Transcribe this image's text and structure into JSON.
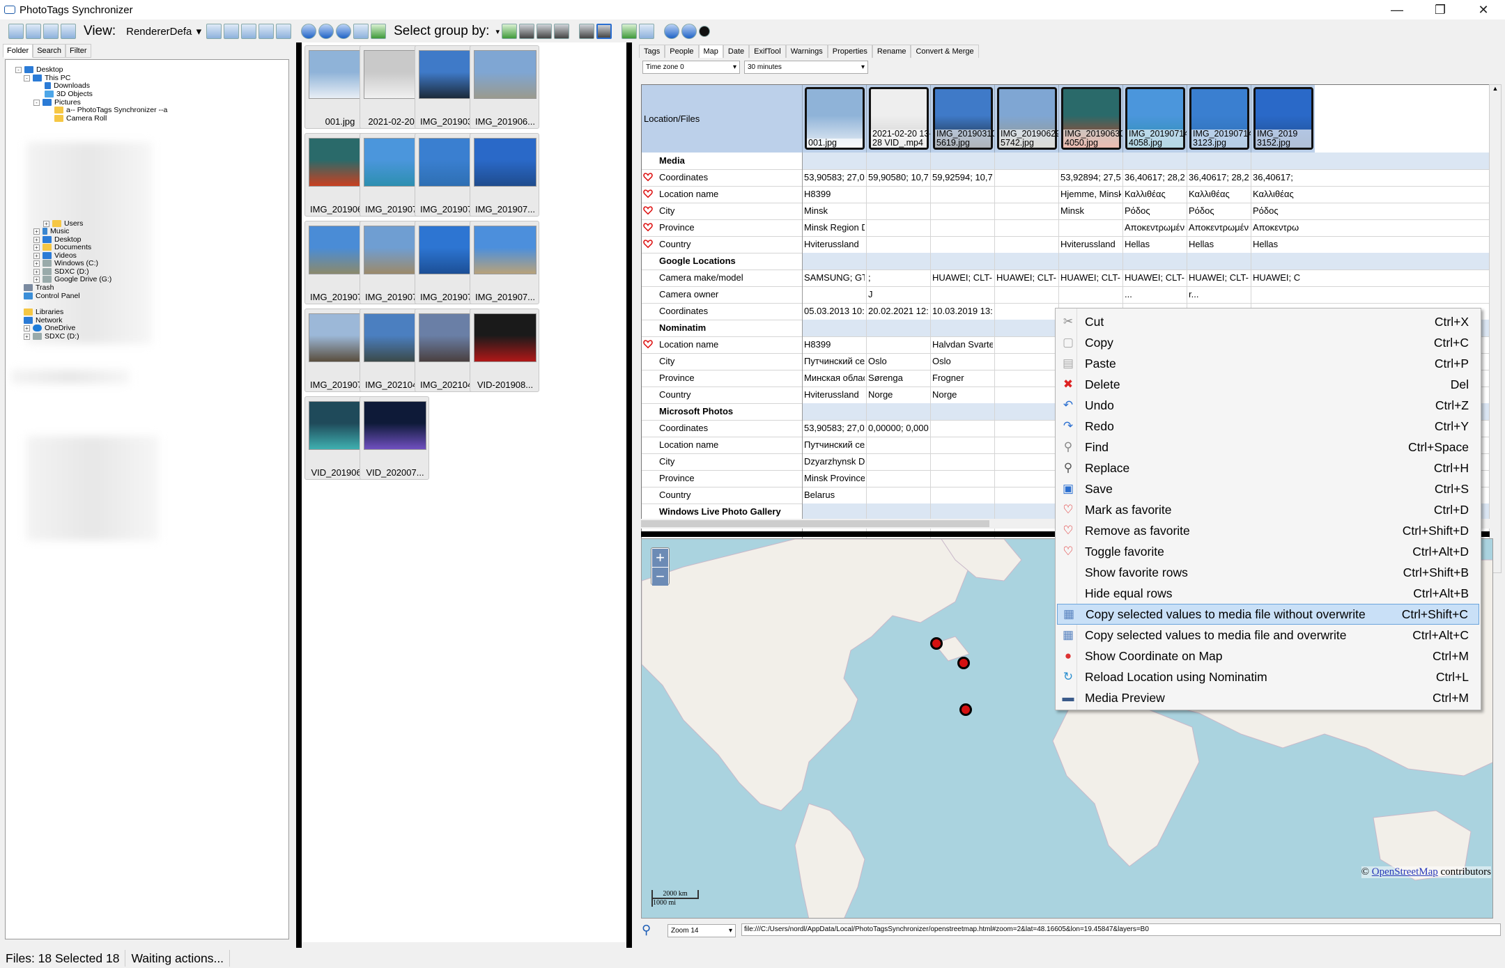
{
  "app": {
    "title": "PhotoTags Synchronizer"
  },
  "toolbar": {
    "view_label": "View:",
    "renderer": "RendererDefa",
    "select_group_label": "Select group by:"
  },
  "left": {
    "tabs": [
      "Folder",
      "Search",
      "Filter"
    ],
    "tree": [
      {
        "label": "Desktop",
        "icon": "desktop-folder-icon"
      },
      {
        "label": "This PC",
        "icon": "this-pc-icon"
      },
      {
        "label": "Downloads",
        "icon": "downloads-folder-icon"
      },
      {
        "label": "3D Objects",
        "icon": "3d-objects-folder-icon"
      },
      {
        "label": "Pictures",
        "icon": "pictures-folder-icon"
      },
      {
        "label": "a-- PhotoTags Synchronizer --a",
        "icon": "folder-icon"
      },
      {
        "label": "Camera Roll",
        "icon": "folder-icon"
      },
      {
        "label": "Users",
        "icon": "folder-icon"
      },
      {
        "label": "Music",
        "icon": "music-folder-icon"
      },
      {
        "label": "Desktop",
        "icon": "desktop-folder-icon"
      },
      {
        "label": "Documents",
        "icon": "documents-folder-icon"
      },
      {
        "label": "Videos",
        "icon": "videos-folder-icon"
      },
      {
        "label": "Windows (C:)",
        "icon": "drive-icon"
      },
      {
        "label": "SDXC (D:)",
        "icon": "drive-icon"
      },
      {
        "label": "Google Drive (G:)",
        "icon": "drive-icon"
      },
      {
        "label": "Trash",
        "icon": "trash-icon"
      },
      {
        "label": "Control Panel",
        "icon": "control-panel-icon"
      },
      {
        "label": "Libraries",
        "icon": "libraries-icon"
      },
      {
        "label": "Network",
        "icon": "network-icon"
      },
      {
        "label": "OneDrive",
        "icon": "onedrive-icon"
      },
      {
        "label": "SDXC (D:)",
        "icon": "drive-icon"
      }
    ]
  },
  "thumbs": [
    {
      "name": "001.jpg",
      "c1": "#8fb3d8",
      "c2": "#e8eef5"
    },
    {
      "name": "2021-02-20...",
      "c1": "#c9c9c9",
      "c2": "#f0f0f0"
    },
    {
      "name": "IMG_201903...",
      "c1": "#3f7ac8",
      "c2": "#1c2a3a"
    },
    {
      "name": "IMG_201906...",
      "c1": "#7fa6d3",
      "c2": "#9a9a8e"
    },
    {
      "name": "IMG_201906...",
      "c1": "#2a6a6a",
      "c2": "#c94020"
    },
    {
      "name": "IMG_201907...",
      "c1": "#4b96dc",
      "c2": "#2d8fb0"
    },
    {
      "name": "IMG_201907...",
      "c1": "#3a7fd0",
      "c2": "#2e6fb3"
    },
    {
      "name": "IMG_201907...",
      "c1": "#2a69c8",
      "c2": "#1f4c8e"
    },
    {
      "name": "IMG_201907...",
      "c1": "#4a8cd6",
      "c2": "#8b8a6c"
    },
    {
      "name": "IMG_201907...",
      "c1": "#6f9ed2",
      "c2": "#9c8a6a"
    },
    {
      "name": "IMG_201907...",
      "c1": "#2d75d2",
      "c2": "#1c4f96"
    },
    {
      "name": "IMG_201907...",
      "c1": "#4c8fdc",
      "c2": "#b8a27a"
    },
    {
      "name": "IMG_201907...",
      "c1": "#9cb8d8",
      "c2": "#5a4e3e"
    },
    {
      "name": "IMG_202104...",
      "c1": "#4b7fc0",
      "c2": "#3b4a4a"
    },
    {
      "name": "IMG_202104...",
      "c1": "#6a7fa6",
      "c2": "#4a4040"
    },
    {
      "name": "VID-201908...",
      "c1": "#1a1a1a",
      "c2": "#b01818"
    },
    {
      "name": "VID_201906...",
      "c1": "#1f4a5a",
      "c2": "#3fb0b0"
    },
    {
      "name": "VID_202007...",
      "c1": "#0e1a38",
      "c2": "#7050c0"
    }
  ],
  "right": {
    "tabs": [
      "Tags",
      "People",
      "Map",
      "Date",
      "ExifTool",
      "Warnings",
      "Properties",
      "Rename",
      "Convert & Merge"
    ],
    "timezone": "Time zone 0",
    "interval": "30 minutes",
    "header_label": "Location/Files",
    "files": [
      {
        "cap": "001.jpg",
        "c1": "#8fb3d8",
        "c2": "#e8eef5"
      },
      {
        "cap": "2021-02-20 13-46-\n28 VID_.mp4",
        "c1": "#eeeeee",
        "c2": "#d0d0d0"
      },
      {
        "cap": "IMG_20190310_14\n5619.jpg",
        "c1": "#3f7ac8",
        "c2": "#1c2a3a"
      },
      {
        "cap": "IMG_20190629_15\n5742.jpg",
        "c1": "#7fa6d3",
        "c2": "#9a9a8e"
      },
      {
        "cap": "IMG_20190630_22\n4050.jpg",
        "c1": "#2a6a6a",
        "c2": "#c94020"
      },
      {
        "cap": "IMG_20190714_15\n4058.jpg",
        "c1": "#4b96dc",
        "c2": "#2d8fb0"
      },
      {
        "cap": "IMG_20190714_16\n3123.jpg",
        "c1": "#3a7fd0",
        "c2": "#2e6fb3"
      },
      {
        "cap": "IMG_2019\n3152.jpg",
        "c1": "#2a69c8",
        "c2": "#1f4c8e"
      }
    ],
    "rows": [
      {
        "label": "Media",
        "group": true,
        "heart": false,
        "vals": [
          "",
          "",
          "",
          "",
          "",
          "",
          "",
          ""
        ]
      },
      {
        "label": "Coordinates",
        "heart": true,
        "vals": [
          "53,90583; 27,00...",
          "59,90580; 10,76...",
          "59,92594; 10,70...",
          "",
          "53,92894; 27,54...",
          "36,40617; 28,22...",
          "36,40617; 28,22...",
          "36,40617;"
        ]
      },
      {
        "label": "Location name",
        "heart": true,
        "vals": [
          "H8399",
          "",
          "",
          "",
          "Hjemme, Minsk",
          "Καλλιθέας",
          "Καλλιθέας",
          "Καλλιθέας"
        ]
      },
      {
        "label": "City",
        "heart": true,
        "vals": [
          "Minsk",
          "",
          "",
          "",
          "Minsk",
          "Ρόδος",
          "Ρόδος",
          "Ρόδος"
        ]
      },
      {
        "label": "Province",
        "heart": true,
        "vals": [
          "Minsk Region Dzy...",
          "",
          "",
          "",
          "",
          "Αποκεντρωμένη ...",
          "Αποκεντρωμένη ...",
          "Αποκεντρω"
        ]
      },
      {
        "label": "Country",
        "heart": true,
        "vals": [
          "Hviterussland",
          "",
          "",
          "",
          "Hviterussland",
          "Hellas",
          "Hellas",
          "Hellas"
        ]
      },
      {
        "label": "Google Locations",
        "group": true,
        "heart": false,
        "vals": [
          "",
          "",
          "",
          "",
          "",
          "",
          "",
          ""
        ]
      },
      {
        "label": "Camera make/model",
        "heart": false,
        "vals": [
          "SAMSUNG; GT-I9...",
          ";",
          "HUAWEI; CLT-L29",
          "HUAWEI; CLT-L29",
          "HUAWEI; CLT-L29",
          "HUAWEI; CLT-L29",
          "HUAWEI; CLT-L29",
          "HUAWEI; C"
        ]
      },
      {
        "label": "Camera owner",
        "heart": false,
        "vals": [
          "",
          "J",
          "",
          "",
          "",
          "...",
          "r...",
          ""
        ]
      },
      {
        "label": "Coordinates",
        "heart": false,
        "vals": [
          "05.03.2013 10:4...",
          "20.02.2021 12:4...",
          "10.03.2019 13:5...",
          "",
          "",
          "",
          "",
          ""
        ]
      },
      {
        "label": "Nominatim",
        "group": true,
        "heart": false,
        "vals": [
          "",
          "",
          "",
          "",
          "",
          "",
          "",
          ""
        ]
      },
      {
        "label": "Location name",
        "heart": true,
        "vals": [
          "H8399",
          "",
          "Halvdan Svartes",
          "",
          "",
          "",
          "",
          ""
        ]
      },
      {
        "label": "City",
        "heart": false,
        "vals": [
          "Путчинский сел...",
          "Oslo",
          "Oslo",
          "",
          "",
          "",
          "",
          ""
        ]
      },
      {
        "label": "Province",
        "heart": false,
        "vals": [
          "Минская област...",
          "Sørenga",
          "Frogner",
          "",
          "",
          "",
          "",
          ""
        ]
      },
      {
        "label": "Country",
        "heart": false,
        "vals": [
          "Hviterussland",
          "Norge",
          "Norge",
          "",
          "",
          "",
          "",
          ""
        ]
      },
      {
        "label": "Microsoft Photos",
        "group": true,
        "heart": false,
        "vals": [
          "",
          "",
          "",
          "",
          "",
          "",
          "",
          ""
        ]
      },
      {
        "label": "Coordinates",
        "heart": false,
        "vals": [
          "53,90583; 27,00...",
          "0,00000; 0,00000",
          "",
          "",
          "",
          "",
          "",
          ""
        ]
      },
      {
        "label": "Location name",
        "heart": false,
        "vals": [
          "Путчинский сел...",
          "",
          "",
          "",
          "",
          "",
          "",
          ""
        ]
      },
      {
        "label": "City",
        "heart": false,
        "vals": [
          "Dzyarzhynsk Dist...",
          "",
          "",
          "",
          "",
          "",
          "",
          ""
        ]
      },
      {
        "label": "Province",
        "heart": false,
        "vals": [
          "Minsk Province",
          "",
          "",
          "",
          "",
          "",
          "",
          ""
        ]
      },
      {
        "label": "Country",
        "heart": false,
        "vals": [
          "Belarus",
          "",
          "",
          "",
          "",
          "",
          "",
          ""
        ]
      },
      {
        "label": "Windows Live Photo Gallery",
        "group": true,
        "heart": false,
        "vals": [
          "",
          "",
          "",
          "",
          "",
          "",
          "",
          ""
        ]
      }
    ],
    "map": {
      "attribution_prefix": "© ",
      "attribution_link": "OpenStreetMap",
      "attribution_suffix": " contributors",
      "scale_km": "2000 km",
      "scale_mi": "1000 mi"
    },
    "zoom": "Zoom 14",
    "url": "file:///C:/Users/nordl/AppData/Local/PhotoTagsSynchronizer/openstreetmap.html#zoom=2&lat=48.16605&lon=19.45847&layers=B0"
  },
  "context_menu": [
    {
      "label": "Cut",
      "shortcut": "Ctrl+X",
      "icon": "scissors-icon"
    },
    {
      "label": "Copy",
      "shortcut": "Ctrl+C",
      "icon": "copy-icon"
    },
    {
      "label": "Paste",
      "shortcut": "Ctrl+P",
      "icon": "paste-icon"
    },
    {
      "label": "Delete",
      "shortcut": "Del",
      "icon": "delete-icon"
    },
    {
      "label": "Undo",
      "shortcut": "Ctrl+Z",
      "icon": "undo-icon"
    },
    {
      "label": "Redo",
      "shortcut": "Ctrl+Y",
      "icon": "redo-icon"
    },
    {
      "label": "Find",
      "shortcut": "Ctrl+Space",
      "icon": "find-icon"
    },
    {
      "label": "Replace",
      "shortcut": "Ctrl+H",
      "icon": "replace-icon"
    },
    {
      "label": "Save",
      "shortcut": "Ctrl+S",
      "icon": "save-icon"
    },
    {
      "label": "Mark as favorite",
      "shortcut": "Ctrl+D",
      "icon": "heart-icon"
    },
    {
      "label": "Remove as favorite",
      "shortcut": "Ctrl+Shift+D",
      "icon": "heart-icon"
    },
    {
      "label": "Toggle favorite",
      "shortcut": "Ctrl+Alt+D",
      "icon": "heart-icon"
    },
    {
      "label": "Show favorite rows",
      "shortcut": "Ctrl+Shift+B",
      "icon": ""
    },
    {
      "label": "Hide equal rows",
      "shortcut": "Ctrl+Alt+B",
      "icon": ""
    },
    {
      "label": "Copy selected values to media file without overwrite",
      "shortcut": "Ctrl+Shift+C",
      "icon": "copy-values-icon",
      "selected": true
    },
    {
      "label": "Copy selected values to media file and overwrite",
      "shortcut": "Ctrl+Alt+C",
      "icon": "copy-values-icon"
    },
    {
      "label": "Show Coordinate on Map",
      "shortcut": "Ctrl+M",
      "icon": "map-pin-icon"
    },
    {
      "label": "Reload Location using Nominatim",
      "shortcut": "Ctrl+L",
      "icon": "reload-location-icon"
    },
    {
      "label": "Media Preview",
      "shortcut": "Ctrl+M",
      "icon": "media-preview-icon"
    }
  ],
  "status": {
    "files": "Files: 18 Selected 18",
    "action": "Waiting actions..."
  }
}
